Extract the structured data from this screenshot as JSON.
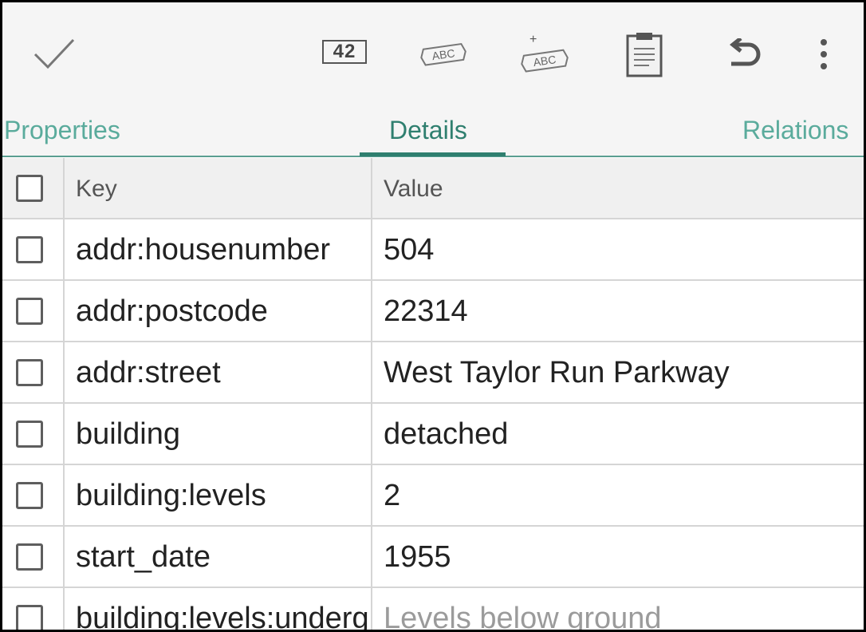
{
  "toolbar": {
    "confirm_icon": "check-icon",
    "number_tag_label": "42",
    "abc_tag_label": "ABC",
    "add_tag_label": "ABC",
    "add_plus": "+",
    "icons": [
      "check-icon",
      "number-tag-icon",
      "abc-tag-icon",
      "add-abc-tag-icon",
      "clipboard-icon",
      "undo-icon",
      "more-vert-icon"
    ]
  },
  "tabs": [
    {
      "label": "Properties"
    },
    {
      "label": "Details",
      "active": true
    },
    {
      "label": "Relations"
    }
  ],
  "table": {
    "headers": {
      "key": "Key",
      "value": "Value"
    },
    "rows": [
      {
        "key": "addr:housenumber",
        "value": "504"
      },
      {
        "key": "addr:postcode",
        "value": "22314"
      },
      {
        "key": "addr:street",
        "value": "West Taylor Run Parkway"
      },
      {
        "key": "building",
        "value": "detached"
      },
      {
        "key": "building:levels",
        "value": "2"
      },
      {
        "key": "start_date",
        "value": "1955"
      },
      {
        "key": "building:levels:underground",
        "value": "",
        "value_placeholder": "Levels below ground"
      }
    ]
  },
  "colors": {
    "accent": "#2f7f6f",
    "tab_inactive": "#5aab9c",
    "toolbar_bg": "#f5f5f5"
  }
}
